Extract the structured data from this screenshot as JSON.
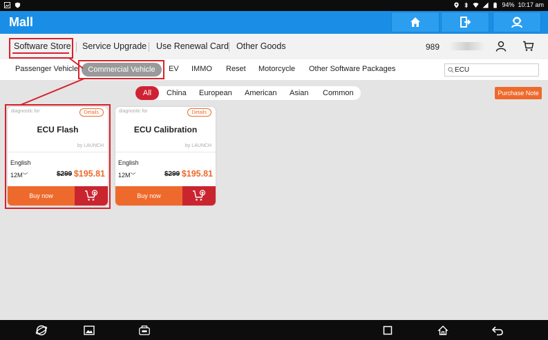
{
  "status_bar": {
    "time": "10:17 am",
    "battery": "94%"
  },
  "header": {
    "title": "Mall"
  },
  "top_nav": {
    "items": [
      "Software Store",
      "Service Upgrade",
      "Use Renewal Card",
      "Other Goods"
    ],
    "account_visible": "989"
  },
  "sub_nav": {
    "items": [
      "Passenger Vehicle",
      "Commercial Vehicle",
      "EV",
      "IMMO",
      "Reset",
      "Motorcycle",
      "Other Software Packages"
    ],
    "active": "Commercial Vehicle"
  },
  "search": {
    "value": "ECU"
  },
  "region_filter": {
    "items": [
      "All",
      "China",
      "European",
      "American",
      "Asian",
      "Common"
    ]
  },
  "purchase_note": "Purchase Note",
  "products": [
    {
      "diag": "diagnostic for",
      "details": "Details",
      "name": "ECU Flash",
      "by": "by LAUNCH",
      "language": "English",
      "duration": "12M",
      "old_price": "$299",
      "price": "$195.81",
      "buy": "Buy now"
    },
    {
      "diag": "diagnostic for",
      "details": "Details",
      "name": "ECU Calibration",
      "by": "by LAUNCH",
      "language": "English",
      "duration": "12M",
      "old_price": "$299",
      "price": "$195.81",
      "buy": "Buy now"
    }
  ],
  "colors": {
    "header_blue": "#1a8ee6",
    "accent_orange": "#ee6a2c",
    "accent_red": "#c9252f",
    "highlight_red": "#d8212a"
  }
}
